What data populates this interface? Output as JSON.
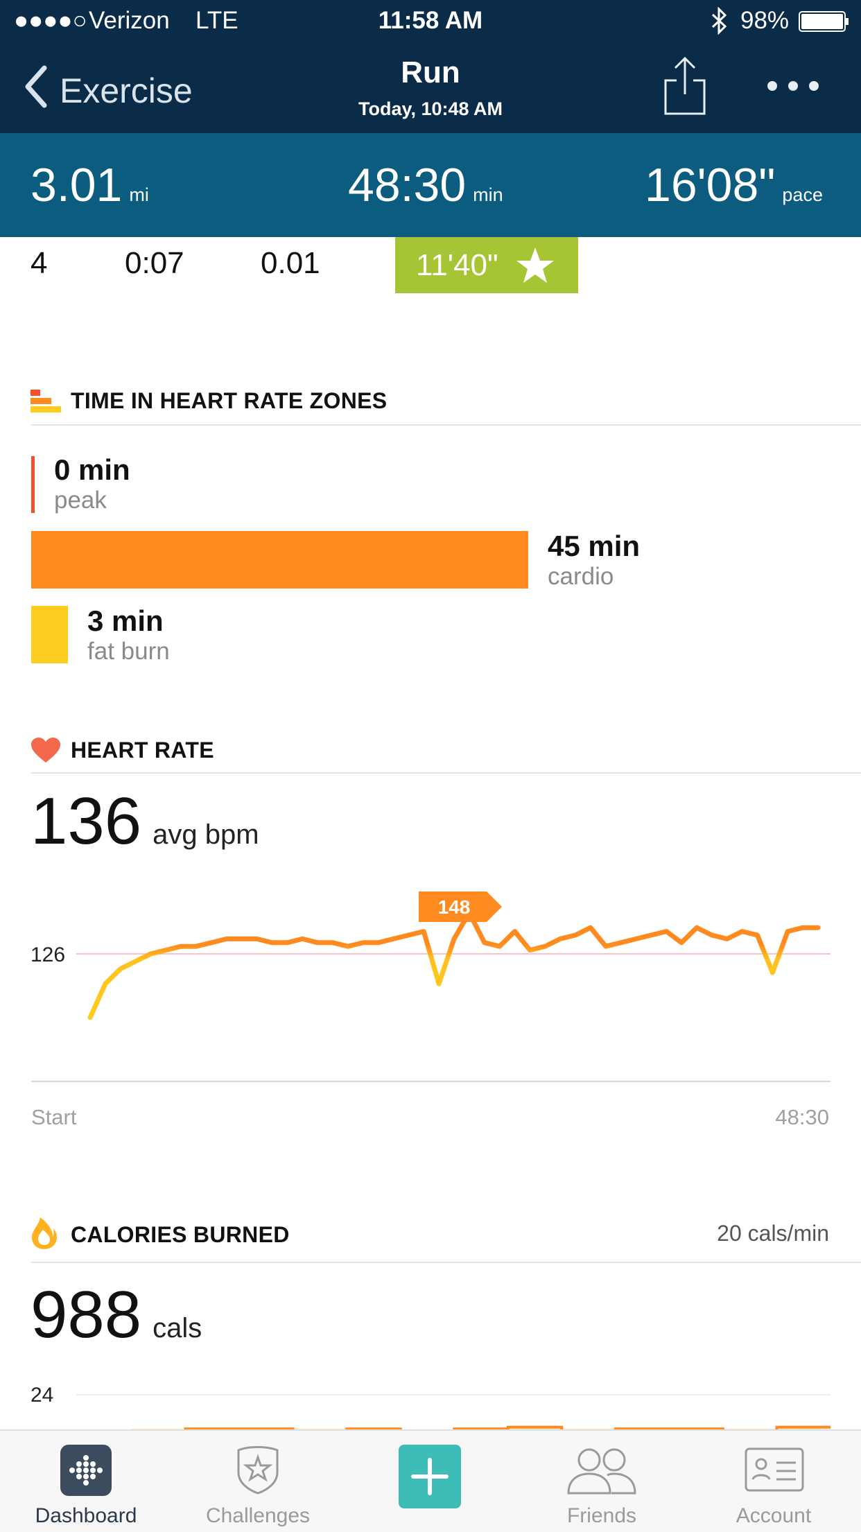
{
  "status_bar": {
    "signal_dots": "●●●●○",
    "carrier": "Verizon",
    "network": "LTE",
    "time": "11:58 AM",
    "battery_percent": "98%",
    "battery_level": 0.98
  },
  "nav": {
    "back_label": "Exercise",
    "title": "Run",
    "subtitle": "Today, 10:48 AM"
  },
  "summary": {
    "distance": "3.01",
    "distance_unit": "mi",
    "duration": "48:30",
    "duration_unit": "min",
    "pace": "16'08\"",
    "pace_unit": "pace"
  },
  "split_row": {
    "number": "4",
    "time": "0:07",
    "distance": "0.01",
    "best_pace": "11'40\""
  },
  "hr_zones": {
    "title": "TIME IN HEART RATE ZONES",
    "zones": [
      {
        "value": "0 min",
        "label": "peak",
        "minutes": 0,
        "color": "#f4502b"
      },
      {
        "value": "45 min",
        "label": "cardio",
        "minutes": 45,
        "color": "#ff8a1f"
      },
      {
        "value": "3 min",
        "label": "fat burn",
        "minutes": 3,
        "color": "#ffcd1f"
      }
    ]
  },
  "heart_rate": {
    "title": "HEART RATE",
    "avg_value": "136",
    "avg_unit": "avg bpm",
    "ref_line_label": "126",
    "peak_marker_label": "148",
    "x_start_label": "Start",
    "x_end_label": "48:30"
  },
  "calories": {
    "title": "CALORIES BURNED",
    "rate": "20 cals/min",
    "total": "988",
    "total_unit": "cals",
    "axis_label": "24"
  },
  "tabs": [
    {
      "label": "Dashboard",
      "active": true
    },
    {
      "label": "Challenges",
      "active": false
    },
    {
      "label": "Friends",
      "active": false
    },
    {
      "label": "Account",
      "active": false
    }
  ],
  "colors": {
    "nav_background": "#0b2c48",
    "summary_background": "#0b5c7e",
    "best_pace_background": "#a6c535",
    "cardio": "#ff8a1f",
    "fat_burn": "#ffcd1f",
    "peak": "#f4502b",
    "add_button": "#3dbcb8",
    "heart_icon": "#f4694c"
  },
  "chart_data": [
    {
      "type": "line",
      "title": "HEART RATE",
      "xlabel": "",
      "ylabel": "",
      "x_tick_labels": [
        "Start",
        "48:30"
      ],
      "y_reference": 126,
      "ylim": [
        105,
        155
      ],
      "x": [
        0,
        1,
        2,
        3,
        4,
        5,
        6,
        7,
        8,
        9,
        10,
        11,
        12,
        13,
        14,
        15,
        16,
        17,
        18,
        19,
        20,
        21,
        22,
        23,
        24,
        25,
        26,
        27,
        28,
        29,
        30,
        31,
        32,
        33,
        34,
        35,
        36,
        37,
        38,
        39,
        40,
        41,
        42,
        43,
        44,
        45,
        46,
        47,
        48
      ],
      "series": [
        {
          "values": [
            109,
            118,
            122,
            124,
            126,
            127,
            128,
            128,
            129,
            130,
            130,
            130,
            129,
            129,
            130,
            129,
            129,
            128,
            129,
            129,
            130,
            131,
            132,
            118,
            130,
            137,
            129,
            128,
            132,
            127,
            128,
            130,
            131,
            133,
            128,
            129,
            130,
            131,
            132,
            129,
            133,
            131,
            130,
            132,
            131,
            121,
            132,
            133,
            133
          ],
          "peak": 148
        }
      ]
    },
    {
      "type": "area",
      "title": "CALORIES BURNED",
      "xlabel": "",
      "ylabel": "",
      "y_tick_labels": [
        "24"
      ],
      "ylim": [
        0,
        24
      ],
      "x": [
        0,
        4,
        8,
        12,
        16,
        20,
        24,
        28,
        32,
        36,
        40,
        44,
        48
      ],
      "series": [
        {
          "values": [
            20,
            21,
            21,
            20,
            21,
            19,
            21,
            22,
            20,
            21,
            21,
            20,
            22
          ]
        }
      ]
    }
  ]
}
